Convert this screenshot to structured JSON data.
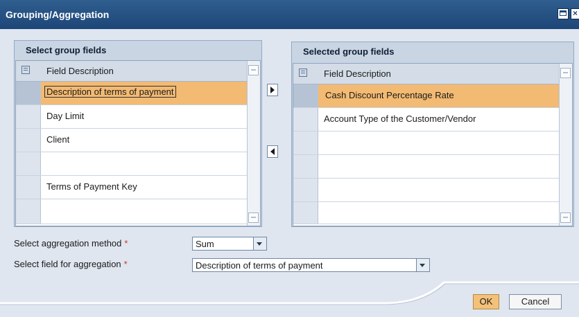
{
  "window": {
    "title": "Grouping/Aggregation"
  },
  "left_panel": {
    "title": "Select group fields",
    "header": "Field Description",
    "rows": [
      "Description of terms of payment",
      "Day Limit",
      "Client",
      "",
      "Terms of Payment Key",
      ""
    ]
  },
  "right_panel": {
    "title": "Selected group fields",
    "header": "Field Description",
    "rows": [
      "Cash Discount Percentage Rate",
      "Account Type of the Customer/Vendor",
      "",
      "",
      "",
      ""
    ]
  },
  "form": {
    "method_label": "Select aggregation method",
    "method_value": "Sum",
    "field_label": "Select field for aggregation",
    "field_value": "Description of terms of payment",
    "required_mark": "*"
  },
  "buttons": {
    "ok": "OK",
    "cancel": "Cancel"
  },
  "colors": {
    "titlebar": "#1d4677",
    "highlight": "#f2ba72",
    "panel": "#c9d5e3"
  }
}
